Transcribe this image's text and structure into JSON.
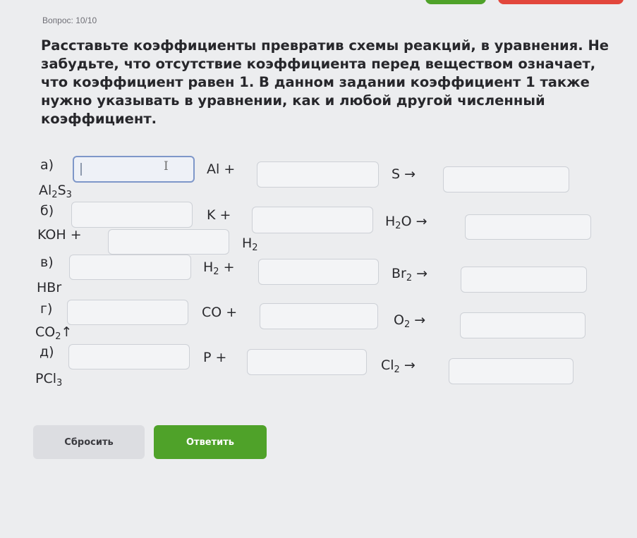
{
  "header": {
    "question_counter": "Вопрос: 10/10"
  },
  "task": {
    "instructions": "Расставьте коэффициенты превратив схемы реакций, в уравнения. Не забудьте, что отсутствие коэффициента перед веществом означает, что коэффициент равен 1. В данном задании коэффициент 1 также нужно указывать в уравнении, как и любой другой численный коэффициент."
  },
  "reactions": {
    "a": {
      "label": "а)",
      "t1": "Al +",
      "t2": "S →",
      "product": "Al",
      "product_sub1": "2",
      "product_mid": "S",
      "product_sub2": "3",
      "input1": "",
      "input2": "",
      "input3": ""
    },
    "b": {
      "label": "б)",
      "t1": "K +",
      "t2": "H",
      "t2_sub": "2",
      "t2_end": "O  →",
      "t3": "KOH +",
      "t4": "H",
      "t4_sub": "2",
      "input1": "",
      "input2": "",
      "input3": "",
      "input4": ""
    },
    "v": {
      "label": "в)",
      "t1": "H",
      "t1_sub": "2",
      "t1_end": " +",
      "t2": "Br",
      "t2_sub": "2",
      "t2_end": "  →",
      "product": "HBr",
      "input1": "",
      "input2": "",
      "input3": ""
    },
    "g": {
      "label": "г)",
      "t1": "CO +",
      "t2": "O",
      "t2_sub": "2",
      "t2_end": "  →",
      "product": "CO",
      "product_sub": "2",
      "product_end": "↑",
      "input1": "",
      "input2": "",
      "input3": ""
    },
    "d": {
      "label": "д)",
      "t1": "P +",
      "t2": "Cl",
      "t2_sub": "2",
      "t2_end": "  →",
      "product": "PCl",
      "product_sub": "3",
      "input1": "",
      "input2": "",
      "input3": ""
    }
  },
  "buttons": {
    "reset_label": "Сбросить",
    "answer_label": "Ответить"
  },
  "colors": {
    "answer_button": "#4fa229",
    "top_red_button": "#e2473c",
    "active_input_border": "#7e97c9"
  },
  "icons": {
    "cursor": "text-cursor-icon"
  }
}
